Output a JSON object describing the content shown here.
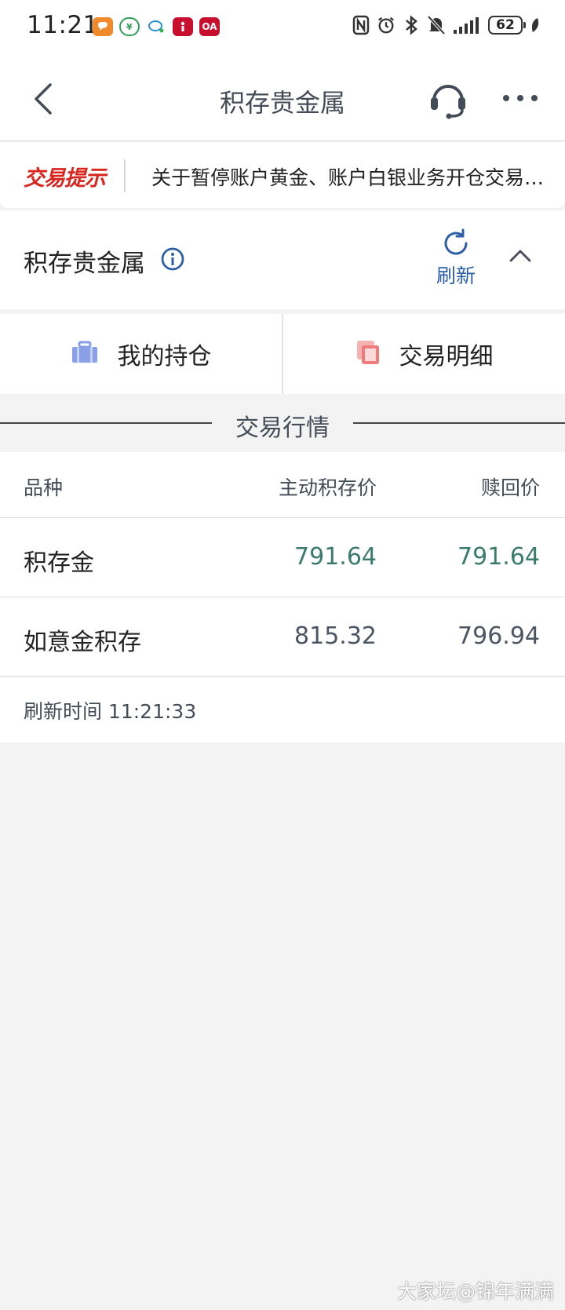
{
  "status_bar": {
    "time": "11:21",
    "battery": "62",
    "app_icons": [
      "app-orange-icon",
      "app-green-icon",
      "app-chat-icon",
      "app-red-icon",
      "app-oa-icon"
    ],
    "oa_label": "OA"
  },
  "nav": {
    "title": "积存贵金属"
  },
  "notice": {
    "tag": "交易提示",
    "text": "关于暂停账户黄金、账户白银业务开仓交易的公告"
  },
  "section": {
    "title": "积存贵金属",
    "refresh_label": "刷新"
  },
  "actions": {
    "holdings_label": "我的持仓",
    "details_label": "交易明细"
  },
  "market": {
    "title": "交易行情",
    "columns": [
      "品种",
      "主动积存价",
      "赎回价"
    ],
    "rows": [
      {
        "name": "积存金",
        "buy": "791.64",
        "sell": "791.64"
      },
      {
        "name": "如意金积存",
        "buy": "815.32",
        "sell": "796.94"
      }
    ],
    "refresh_time": "刷新时间 11:21:33"
  },
  "watermark": "大家坛@锦年满满",
  "colors": {
    "brand_blue": "#2d5ea8",
    "notice_red": "#d8261e",
    "price_green": "#3a7b6c",
    "holdings_icon": "#8aa0e6",
    "details_icon": "#ef7b7b"
  }
}
